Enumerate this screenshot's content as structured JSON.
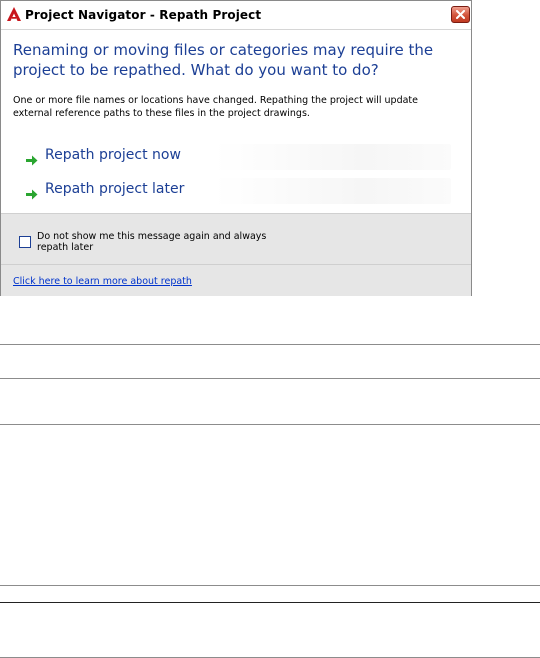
{
  "window": {
    "title": "Project Navigator - Repath Project",
    "app_icon": "autocad-a-icon",
    "close_icon": "close-x-icon"
  },
  "main": {
    "heading": "Renaming or moving files or categories may require the project to be repathed. What do you want to do?",
    "description": "One or more file names or locations have changed. Repathing the project will update external reference paths to these files in the project drawings.",
    "options": [
      {
        "label": "Repath project now",
        "icon": "green-arrow-icon"
      },
      {
        "label": "Repath project later",
        "icon": "green-arrow-icon"
      }
    ]
  },
  "footer": {
    "checkbox_label": "Do not show me this message again and always repath later",
    "checkbox_checked": false,
    "learn_more_link": "Click here to learn more about repath"
  },
  "colors": {
    "heading_blue": "#1c3f95",
    "link_blue": "#0033cc",
    "arrow_green": "#2aa530",
    "footer_gray": "#e6e6e6"
  }
}
